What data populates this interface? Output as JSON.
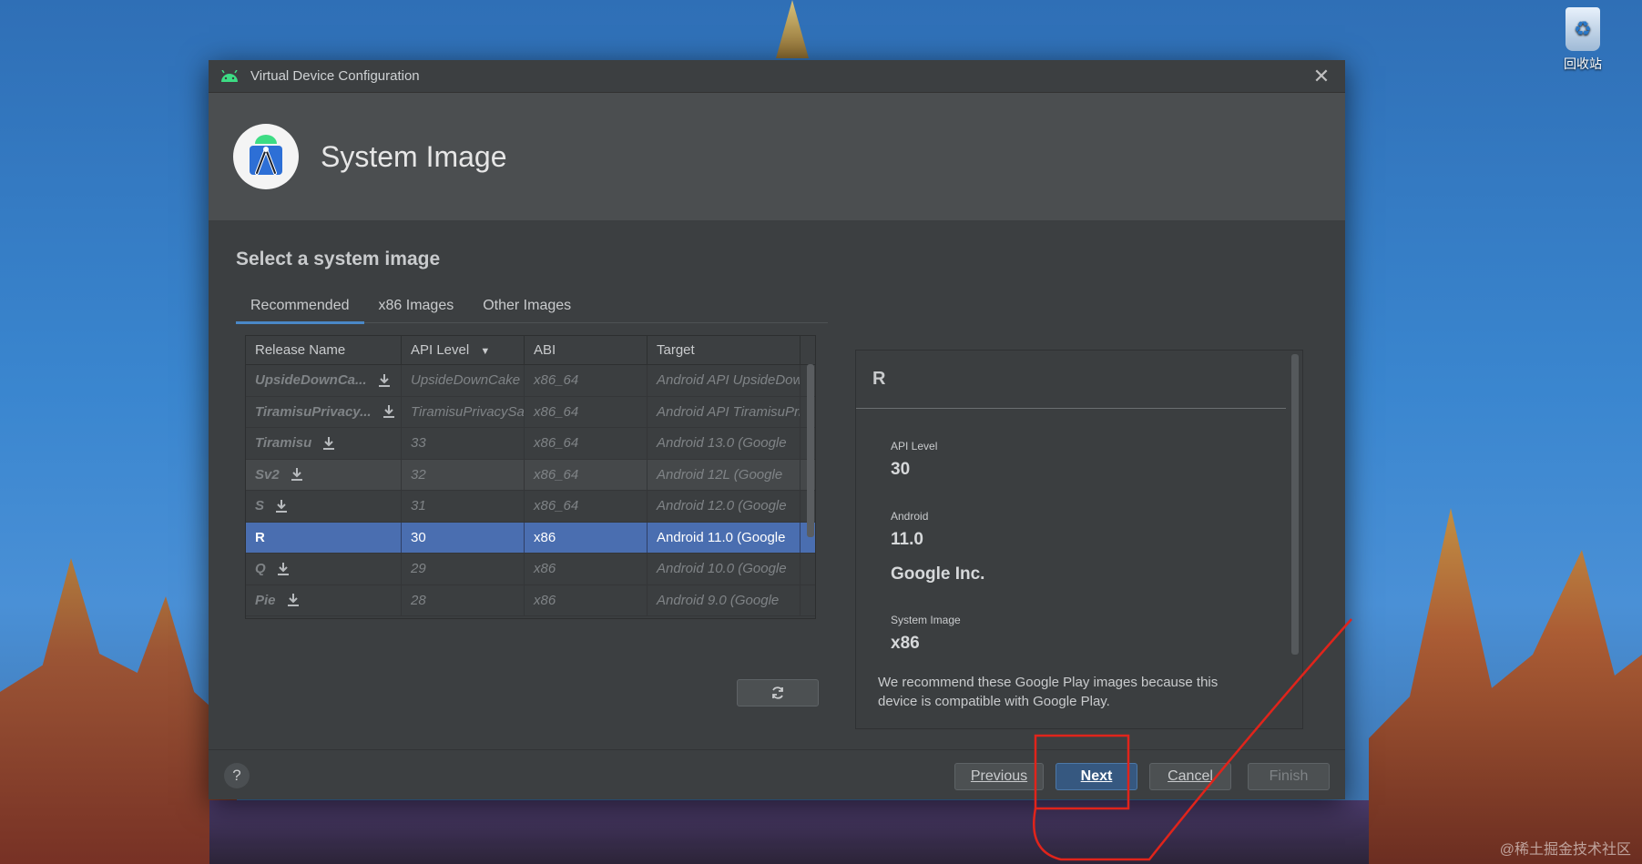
{
  "desktop": {
    "recycle_bin_label": "回收站",
    "watermark": "@稀土掘金技术社区"
  },
  "dialog": {
    "title": "Virtual Device Configuration",
    "header_title": "System Image",
    "section_title": "Select a system image",
    "tabs": [
      {
        "label": "Recommended",
        "active": true
      },
      {
        "label": "x86 Images",
        "active": false
      },
      {
        "label": "Other Images",
        "active": false
      }
    ],
    "table": {
      "columns": [
        "Release Name",
        "API Level",
        "ABI",
        "Target"
      ],
      "sort_column": "API Level",
      "rows": [
        {
          "name": "UpsideDownCa...",
          "api": "UpsideDownCake",
          "abi": "x86_64",
          "target": "Android API UpsideDownCake",
          "download": true
        },
        {
          "name": "TiramisuPrivacy...",
          "api": "TiramisuPrivacySandbox",
          "abi": "x86_64",
          "target": "Android API TiramisuPrivacySandbox",
          "download": true
        },
        {
          "name": "Tiramisu",
          "api": "33",
          "abi": "x86_64",
          "target": "Android 13.0 (Google",
          "download": true
        },
        {
          "name": "Sv2",
          "api": "32",
          "abi": "x86_64",
          "target": "Android 12L (Google",
          "download": true
        },
        {
          "name": "S",
          "api": "31",
          "abi": "x86_64",
          "target": "Android 12.0 (Google",
          "download": true
        },
        {
          "name": "R",
          "api": "30",
          "abi": "x86",
          "target": "Android 11.0 (Google",
          "download": false,
          "selected": true
        },
        {
          "name": "Q",
          "api": "29",
          "abi": "x86",
          "target": "Android 10.0 (Google",
          "download": true
        },
        {
          "name": "Pie",
          "api": "28",
          "abi": "x86",
          "target": "Android 9.0 (Google",
          "download": true
        }
      ]
    },
    "detail": {
      "title": "R",
      "api_level_label": "API Level",
      "api_level_value": "30",
      "android_label": "Android",
      "android_value": "11.0",
      "vendor": "Google Inc.",
      "system_image_label": "System Image",
      "system_image_value": "x86",
      "description": "We recommend these Google Play images because this device is compatible with Google Play."
    },
    "buttons": {
      "help": "?",
      "previous": "Previous",
      "next": "Next",
      "cancel": "Cancel",
      "finish": "Finish"
    },
    "colors": {
      "accent": "#4a88c7",
      "selection": "#4a6eb0",
      "annotation": "#e0241b"
    }
  }
}
